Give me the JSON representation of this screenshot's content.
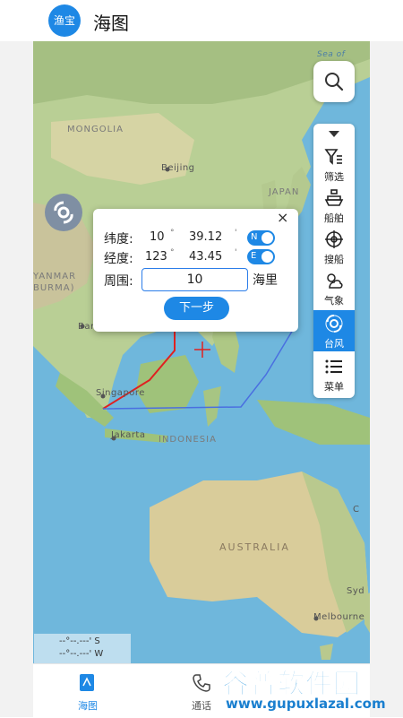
{
  "header": {
    "logo_text": "渔宝",
    "title": "海图"
  },
  "map": {
    "labels": {
      "mongolia": "MONGOLIA",
      "beijing": "Beijing",
      "japan": "JAPAN",
      "myanmar": "YANMAR",
      "burma": "BURMA)",
      "bangkok": "Bang",
      "singapore": "Singapore",
      "jakarta": "Jakarta",
      "indonesia": "INDONESIA",
      "australia": "AUSTRALIA",
      "melbourne": "Melbourne",
      "sydney": "Syd",
      "sea_of": "Sea of",
      "c": "C"
    }
  },
  "side_menu": {
    "items": [
      {
        "label": "筛选",
        "icon": "filter-icon"
      },
      {
        "label": "船舶",
        "icon": "ship-icon"
      },
      {
        "label": "搜船",
        "icon": "target-icon"
      },
      {
        "label": "气象",
        "icon": "weather-icon"
      },
      {
        "label": "台风",
        "icon": "typhoon-icon",
        "active": true
      },
      {
        "label": "菜单",
        "icon": "menu-icon"
      }
    ]
  },
  "dialog": {
    "close": "×",
    "lat_label": "纬度:",
    "lat_deg": "10",
    "lat_min": "39.12",
    "lat_toggle": "N",
    "lon_label": "经度:",
    "lon_deg": "123",
    "lon_min": "43.45",
    "lon_toggle": "E",
    "deg_unit": "°",
    "min_unit": "'",
    "range_label": "周围:",
    "range_value": "10",
    "range_unit": "海里",
    "next_label": "下一步"
  },
  "scale": {
    "line1": "--°--.---' S",
    "line2": "--°--.---' W"
  },
  "bottom_nav": {
    "items": [
      {
        "label": "海图",
        "active": true
      },
      {
        "label": "通话"
      }
    ]
  },
  "watermark": {
    "big": "谷普软件园",
    "small": "www.gupuxlazal.com"
  },
  "colors": {
    "accent": "#1e88e5",
    "route_red": "#e02020",
    "route_blue": "#4a6fe0"
  }
}
